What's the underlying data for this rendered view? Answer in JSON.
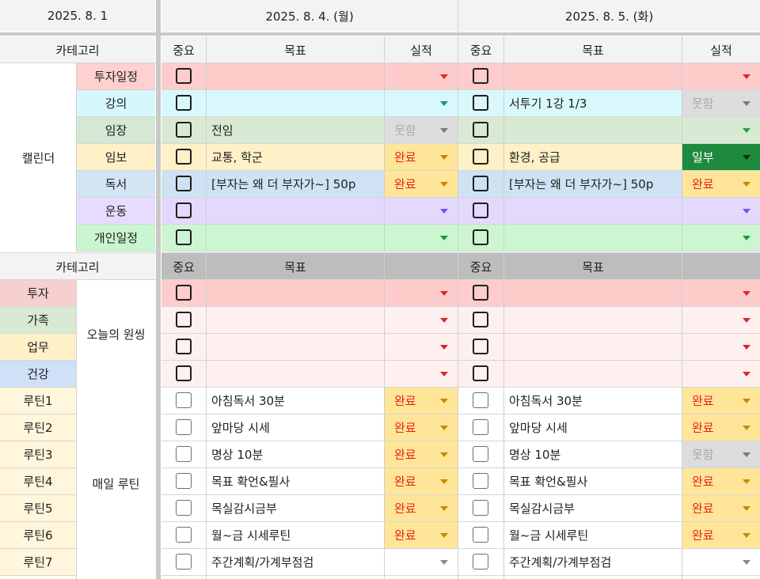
{
  "dates": {
    "left": "2025. 8. 1",
    "day1": "2025. 8. 4. (월)",
    "day2": "2025. 8. 5. (화)"
  },
  "headers": {
    "category": "카테고리",
    "important": "중요",
    "goal": "목표",
    "result": "실적"
  },
  "calendar": {
    "group": "캘린더",
    "rows": [
      {
        "cat": "투자일정",
        "catColor": "#ffd0d0",
        "rowColor": "#ffcccc",
        "arrow": "#e32424",
        "d1": {
          "goal": "",
          "status": ""
        },
        "d2": {
          "goal": "",
          "status": ""
        }
      },
      {
        "cat": "강의",
        "catColor": "#d6f7fb",
        "rowColor": "#d9f8fc",
        "arrow": "#1f8c8c",
        "d1": {
          "goal": "",
          "status": ""
        },
        "d2": {
          "goal": "서투기 1강 1/3",
          "status": "못함"
        }
      },
      {
        "cat": "임장",
        "catColor": "#d5e8d4",
        "rowColor": "#d9ead3",
        "arrow": "#2d9a3a",
        "d1": {
          "goal": "전임",
          "status": "못함"
        },
        "d2": {
          "goal": "",
          "status": ""
        }
      },
      {
        "cat": "임보",
        "catColor": "#fff0c8",
        "rowColor": "#fff1c7",
        "arrow": "#c58a00",
        "d1": {
          "goal": "교통, 학군",
          "status": "완료"
        },
        "d2": {
          "goal": "환경, 공급",
          "status": "일부"
        }
      },
      {
        "cat": "독서",
        "catColor": "#d3e4f5",
        "rowColor": "#cfe2f3",
        "arrow": "#c58a00",
        "d1": {
          "goal": "[부자는 왜 더 부자가~] 50p",
          "status": "완료"
        },
        "d2": {
          "goal": "[부자는 왜 더 부자가~] 50p",
          "status": "완료"
        }
      },
      {
        "cat": "운동",
        "catColor": "#e6dcff",
        "rowColor": "#e2d9fc",
        "arrow": "#6a5af0",
        "d1": {
          "goal": "",
          "status": ""
        },
        "d2": {
          "goal": "",
          "status": ""
        }
      },
      {
        "cat": "개인일정",
        "catColor": "#c9f5d0",
        "rowColor": "#ccf5d2",
        "arrow": "#1e9a3a",
        "d1": {
          "goal": "",
          "status": ""
        },
        "d2": {
          "goal": "",
          "status": ""
        }
      }
    ]
  },
  "onething": {
    "group": "오늘의 원씽",
    "rows": [
      {
        "cat": "투자",
        "catColor": "#f6cfcf"
      },
      {
        "cat": "가족",
        "catColor": "#d8ead2"
      },
      {
        "cat": "업무",
        "catColor": "#fff0c8"
      },
      {
        "cat": "건강",
        "catColor": "#cfe0f7"
      }
    ]
  },
  "routine": {
    "group": "매일 루틴",
    "rows": [
      {
        "cat": "루틴1",
        "d1": {
          "goal": "아침독서 30분",
          "status": "완료"
        },
        "d2": {
          "goal": "아침독서 30분",
          "status": "완료"
        }
      },
      {
        "cat": "루틴2",
        "d1": {
          "goal": "앞마당 시세",
          "status": "완료"
        },
        "d2": {
          "goal": "앞마당 시세",
          "status": "완료"
        }
      },
      {
        "cat": "루틴3",
        "d1": {
          "goal": "명상 10분",
          "status": "완료"
        },
        "d2": {
          "goal": "명상 10분",
          "status": "못함"
        }
      },
      {
        "cat": "루틴4",
        "d1": {
          "goal": "목표 확언&필사",
          "status": "완료"
        },
        "d2": {
          "goal": "목표 확언&필사",
          "status": "완료"
        }
      },
      {
        "cat": "루틴5",
        "d1": {
          "goal": "목실감시금부",
          "status": "완료"
        },
        "d2": {
          "goal": "목실감시금부",
          "status": "완료"
        }
      },
      {
        "cat": "루틴6",
        "d1": {
          "goal": "월~금 시세루틴",
          "status": "완료"
        },
        "d2": {
          "goal": "월~금 시세루틴",
          "status": "완료"
        }
      },
      {
        "cat": "루틴7",
        "d1": {
          "goal": "주간계획/가계부점검",
          "status": ""
        },
        "d2": {
          "goal": "주간계획/가계부점검",
          "status": ""
        }
      }
    ]
  }
}
